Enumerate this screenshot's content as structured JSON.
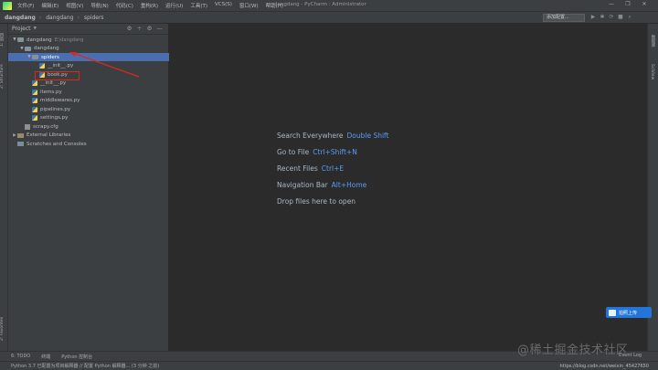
{
  "titlebar": {
    "menu": [
      "文件(F)",
      "编辑(E)",
      "视图(V)",
      "导航(N)",
      "代码(C)",
      "重构(R)",
      "运行(U)",
      "工具(T)",
      "VCS(S)",
      "窗口(W)",
      "帮助(H)"
    ],
    "window_title": "dangdang - PyCharm : Administrator",
    "controls": [
      "—",
      "❐",
      "✕"
    ]
  },
  "navbar": {
    "crumbs": [
      "dangdang",
      "dangdang",
      "spiders"
    ],
    "config_button": "添加配置...",
    "run_icons": [
      "▶",
      "✱",
      "⟳",
      "■",
      "⌕"
    ]
  },
  "left_tabs": [
    "1: 项目",
    "2: Structure",
    "2: Favorites"
  ],
  "right_tabs": [
    "数据库",
    "SciView"
  ],
  "project_panel": {
    "title": "Project",
    "tools": [
      "⚙",
      "÷",
      "⚙",
      "—"
    ],
    "tree": [
      {
        "label": "dangdang",
        "hint": "E:\\dangdang",
        "indent": 0,
        "arrow": "▼",
        "icon": "folder"
      },
      {
        "label": "dangdang",
        "hint": "",
        "indent": 1,
        "arrow": "▼",
        "icon": "folder"
      },
      {
        "label": "spiders",
        "hint": "",
        "indent": 2,
        "arrow": "▼",
        "icon": "folder",
        "selected": true
      },
      {
        "label": "__init__.py",
        "hint": "",
        "indent": 3,
        "arrow": "",
        "icon": "py"
      },
      {
        "label": "book.py",
        "hint": "",
        "indent": 3,
        "arrow": "",
        "icon": "py"
      },
      {
        "label": "__init__.py",
        "hint": "",
        "indent": 2,
        "arrow": "",
        "icon": "py"
      },
      {
        "label": "items.py",
        "hint": "",
        "indent": 2,
        "arrow": "",
        "icon": "py"
      },
      {
        "label": "middlewares.py",
        "hint": "",
        "indent": 2,
        "arrow": "",
        "icon": "py"
      },
      {
        "label": "pipelines.py",
        "hint": "",
        "indent": 2,
        "arrow": "",
        "icon": "py"
      },
      {
        "label": "settings.py",
        "hint": "",
        "indent": 2,
        "arrow": "",
        "icon": "py"
      },
      {
        "label": "scrapy.cfg",
        "hint": "",
        "indent": 1,
        "arrow": "",
        "icon": "cfg"
      },
      {
        "label": "External Libraries",
        "hint": "",
        "indent": 0,
        "arrow": "▶",
        "icon": "lib"
      },
      {
        "label": "Scratches and Consoles",
        "hint": "",
        "indent": 0,
        "arrow": "",
        "icon": "cons"
      }
    ]
  },
  "editor": {
    "hints": [
      {
        "label": "Search Everywhere",
        "shortcut": "Double Shift"
      },
      {
        "label": "Go to File",
        "shortcut": "Ctrl+Shift+N"
      },
      {
        "label": "Recent Files",
        "shortcut": "Ctrl+E"
      },
      {
        "label": "Navigation Bar",
        "shortcut": "Alt+Home"
      },
      {
        "label": "Drop files here to open",
        "shortcut": ""
      }
    ],
    "upload_button": "拍照上传"
  },
  "bottom_tools": [
    "6: TODO",
    "终端",
    "Python 控制台"
  ],
  "event_log": "Event Log",
  "watermark": "@稀土掘金技术社区",
  "status_bar": {
    "message": "Python 3.7 已配置为项目解释器 // 配置 Python 解释器... (3 分钟 之前)",
    "url": "https://blog.csdn.net/weixin_45427650"
  },
  "colors": {
    "selection": "#4b6eaf",
    "shortcut": "#589df6",
    "annotation": "#e0261b"
  }
}
